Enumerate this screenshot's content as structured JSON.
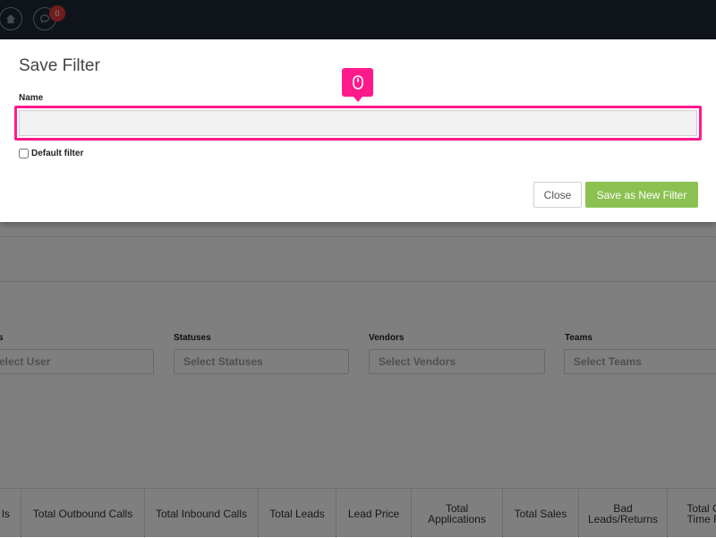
{
  "header": {
    "icons": [
      "home-icon",
      "chat-icon"
    ],
    "badge_count": "0"
  },
  "filters": [
    {
      "label": "s",
      "placeholder": "elect User"
    },
    {
      "label": "Statuses",
      "placeholder": "Select Statuses"
    },
    {
      "label": "Vendors",
      "placeholder": "Select Vendors"
    },
    {
      "label": "Teams",
      "placeholder": "Select Teams"
    }
  ],
  "table": {
    "columns": [
      [
        "ls"
      ],
      [
        "Total Outbound Calls"
      ],
      [
        "Total Inbound Calls"
      ],
      [
        "Total Leads"
      ],
      [
        "Lead Price"
      ],
      [
        "Total",
        "Applications"
      ],
      [
        "Total Sales"
      ],
      [
        "Bad",
        "Leads/Returns"
      ],
      [
        "Total C",
        "Time F"
      ]
    ]
  },
  "modal": {
    "title": "Save Filter",
    "name_label": "Name",
    "name_value": "",
    "default_filter_label": "Default filter",
    "default_filter_checked": false,
    "close_label": "Close",
    "save_label": "Save as New Filter"
  },
  "colors": {
    "highlight": "#ff1a8c",
    "save_button": "#8cc152",
    "topbar": "#1e2835"
  },
  "annotation": {
    "icon": "mouse-click-icon"
  }
}
